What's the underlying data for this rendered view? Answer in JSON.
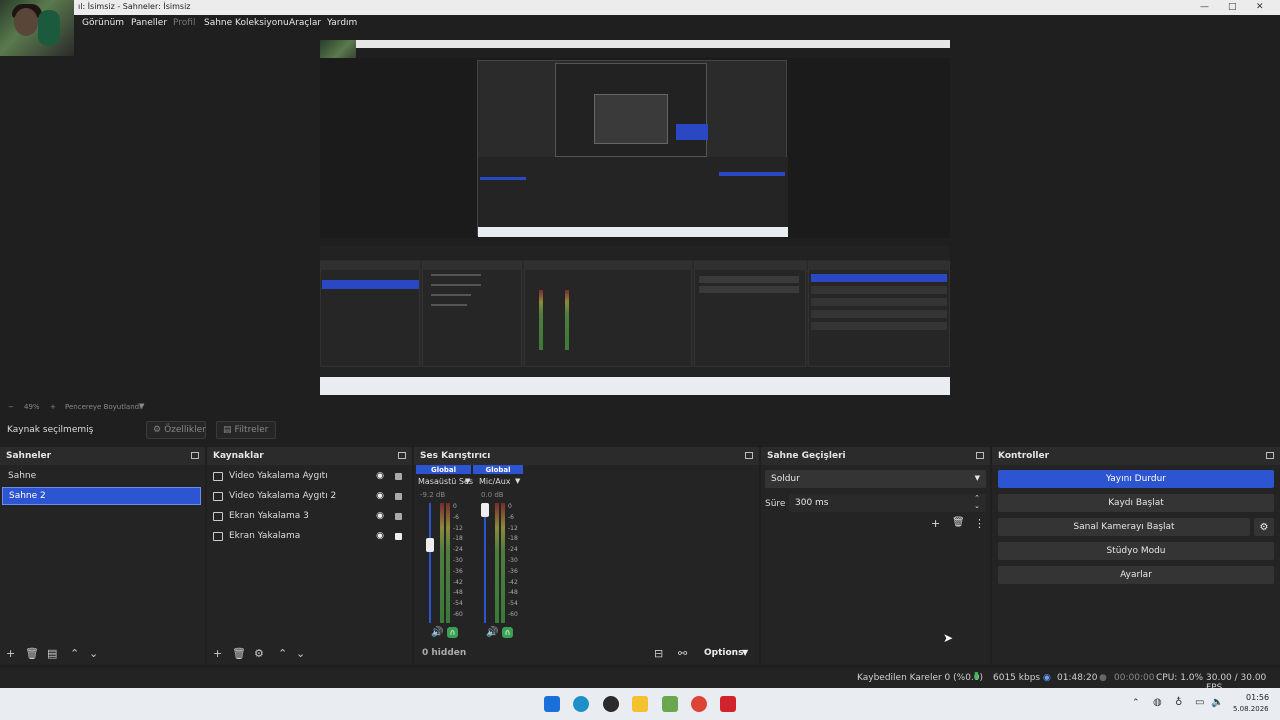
{
  "window": {
    "title": "ıl: İsimsiz - Sahneler: İsimsiz"
  },
  "menu": {
    "items": [
      "Görünüm",
      "Paneller",
      "Profil",
      "Sahne Koleksiyonu",
      "Araçlar",
      "Yardım"
    ]
  },
  "preview_bar": {
    "zoom": "49%",
    "fit_label": "Pencereye Boyutlandır"
  },
  "source_bar": {
    "no_source": "Kaynak seçilmemiş",
    "properties": "Özellikler",
    "filters": "Filtreler"
  },
  "scenes": {
    "title": "Sahneler",
    "items": [
      "Sahne",
      "Sahne 2"
    ],
    "selected": "Sahne 2"
  },
  "sources": {
    "title": "Kaynaklar",
    "items": [
      {
        "name": "Video Yakalama Aygıtı",
        "icon": "camera-icon"
      },
      {
        "name": "Video Yakalama Aygıtı 2",
        "icon": "camera-icon"
      },
      {
        "name": "Ekran Yakalama 3",
        "icon": "monitor-icon"
      },
      {
        "name": "Ekran Yakalama",
        "icon": "monitor-icon"
      }
    ]
  },
  "mixer": {
    "title": "Ses Karıştırıcı",
    "channels": [
      {
        "tag": "Global",
        "name": "Masaüstü Ses",
        "db": "-9.2 dB"
      },
      {
        "tag": "Global",
        "name": "Mic/Aux",
        "db": "0.0 dB"
      }
    ],
    "scale": [
      "0",
      "-6",
      "-12",
      "-18",
      "-24",
      "-30",
      "-36",
      "-42",
      "-48",
      "-54",
      "-60"
    ],
    "hidden": "0 hidden",
    "options": "Options"
  },
  "transitions": {
    "title": "Sahne Geçişleri",
    "selected": "Soldur",
    "duration_label": "Süre",
    "duration_value": "300 ms"
  },
  "controls": {
    "title": "Kontroller",
    "stop_stream": "Yayını Durdur",
    "start_record": "Kaydı Başlat",
    "virtual_cam": "Sanal Kamerayı Başlat",
    "studio_mode": "Stüdyo Modu",
    "settings": "Ayarlar"
  },
  "status": {
    "dropped": "Kaybedilen Kareler 0 (%0.0)",
    "bitrate": "6015 kbps",
    "stream_time": "01:48:20",
    "rec_time": "00:00:00",
    "cpu": "CPU: 1.0%",
    "fps": "30.00 / 30.00 FPS"
  },
  "taskbar": {
    "time": "01:56",
    "date": "5.08.2026"
  },
  "colors": {
    "accent": "#2e55d1",
    "panel_bg": "#242424",
    "app_bg": "#1f1f1f"
  }
}
